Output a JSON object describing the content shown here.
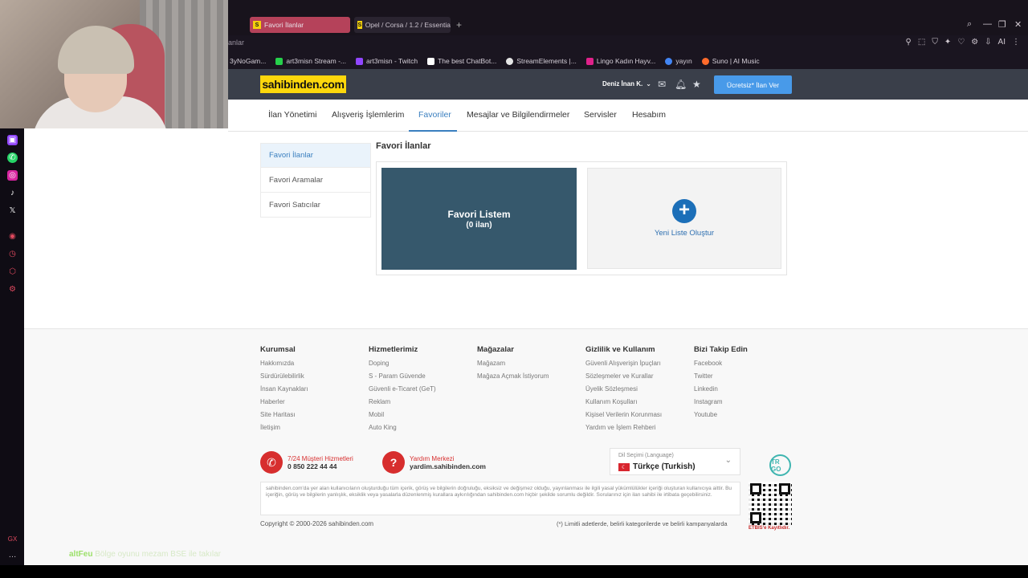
{
  "browser": {
    "tabs": [
      {
        "label": "Favori İlanlar",
        "favicon": "S"
      },
      {
        "label": "Opel / Corsa / 1.2 / Essentia",
        "favicon": "S"
      }
    ],
    "new_tab": "+",
    "address_partial": "anlar",
    "bookmarks": [
      {
        "label": "3yNoGam...",
        "color": "#555555"
      },
      {
        "label": "art3misn Stream -...",
        "color": "#26d04b"
      },
      {
        "label": "art3misn - Twitch",
        "color": "#9146ff"
      },
      {
        "label": "The best ChatBot...",
        "color": "#ffffff"
      },
      {
        "label": "StreamElements |...",
        "color": "#ffffff"
      },
      {
        "label": "Lingo Kadın Hayv...",
        "color": "#e0218a"
      },
      {
        "label": "yayın",
        "color": "#4285f4"
      },
      {
        "label": "Suno | AI Music",
        "color": "#ff6b2b"
      }
    ],
    "ai_label": "AI"
  },
  "site": {
    "logo": "sahibinden.com",
    "user": "Deniz İnan K.",
    "post_button": "Ücretsiz* İlan Ver",
    "nav": [
      "İlan Yönetimi",
      "Alışveriş İşlemlerim",
      "Favoriler",
      "Mesajlar ve Bilgilendirmeler",
      "Servisler",
      "Hesabım"
    ],
    "side_menu": [
      "Favori İlanlar",
      "Favori Aramalar",
      "Favori Satıcılar"
    ],
    "section_title": "Favori İlanlar",
    "fav_list_title": "Favori Listem",
    "fav_list_count": "(0 ilan)",
    "new_list_label": "Yeni Liste Oluştur"
  },
  "footer": {
    "columns": [
      {
        "title": "Kurumsal",
        "items": [
          "Hakkımızda",
          "Sürdürülebilirlik",
          "İnsan Kaynakları",
          "Haberler",
          "Site Haritası",
          "İletişim"
        ]
      },
      {
        "title": "Hizmetlerimiz",
        "items": [
          "Doping",
          "S - Param Güvende",
          "Güvenli e-Ticaret (GeT)",
          "Reklam",
          "Mobil",
          "Auto King"
        ]
      },
      {
        "title": "Mağazalar",
        "items": [
          "Mağazam",
          "Mağaza Açmak İstiyorum"
        ]
      },
      {
        "title": "Gizlilik ve Kullanım",
        "items": [
          "Güvenli Alışverişin İpuçları",
          "Sözleşmeler ve Kurallar",
          "Üyelik Sözleşmesi",
          "Kullanım Koşulları",
          "Kişisel Verilerin Korunması",
          "Yardım ve İşlem Rehberi"
        ]
      },
      {
        "title": "Bizi Takip Edin",
        "items": [
          "Facebook",
          "Twitter",
          "Linkedin",
          "Instagram",
          "Youtube"
        ]
      }
    ],
    "support_phone_label": "7/24 Müşteri Hizmetleri",
    "support_phone": "0 850 222 44 44",
    "help_label": "Yardım Merkezi",
    "help_url": "yardim.sahibinden.com",
    "lang_label": "Dil Seçimi (Language)",
    "lang_value": "Türkçe (Turkish)",
    "trgo": "TR GO",
    "disclaimer": "sahibinden.com'da yer alan kullanıcıların oluşturduğu tüm içerik, görüş ve bilgilerin doğruluğu, eksiksiz ve değişmez olduğu, yayınlanması ile ilgili yasal yükümlülükler içeriği oluşturan kullanıcıya aittir. Bu içeriğin, görüş ve bilgilerin yanlışlık, eksiklik veya yasalarla düzenlenmiş kurallara aykırılığından sahibinden.com hiçbir şekilde sorumlu değildir. Sorularınız için ilan sahibi ile irtibata geçebilirsiniz.",
    "copyright": "Copyright © 2000-2026 sahibinden.com",
    "limit_note": "(*) Limitli adetlerde, belirli kategorilerde ve belirli kampanyalarda",
    "etbis": "ETBIS'e Kayıtlıdır."
  },
  "overlay": {
    "brand": "altFeu",
    "text": "Bölge oyunu mezam BSE ile takılar"
  }
}
